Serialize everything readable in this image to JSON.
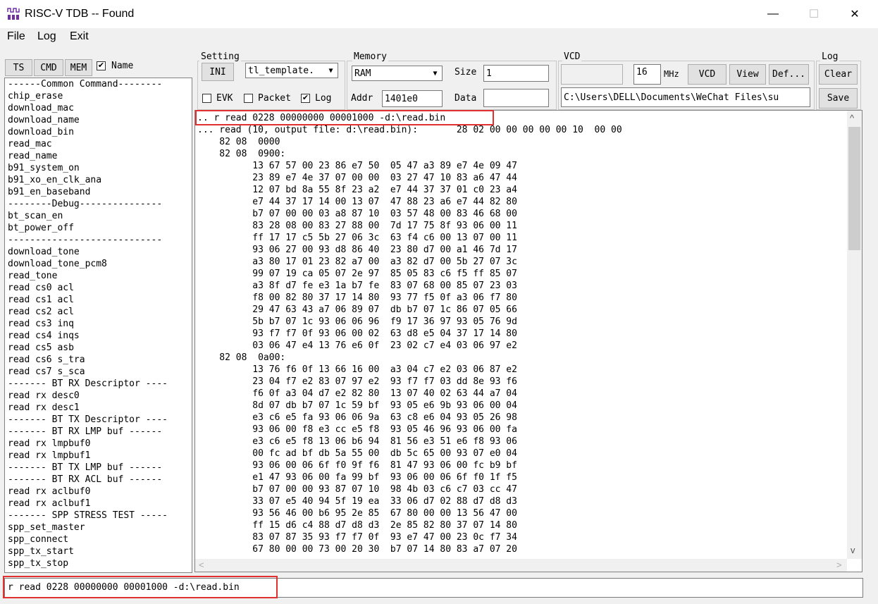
{
  "window": {
    "title": "RISC-V TDB -- Found",
    "min_glyph": "—",
    "max_glyph": "☐",
    "close_glyph": "✕"
  },
  "menu": [
    "File",
    "Log",
    "Exit"
  ],
  "left_tabs": {
    "ts": "TS",
    "cmd": "CMD",
    "mem": "MEM",
    "name_checked": true,
    "name_label": "Name"
  },
  "commands": [
    "------Common Command--------",
    "chip_erase",
    "download_mac",
    "download_name",
    "download_bin",
    "read_mac",
    "read_name",
    "b91_system_on",
    "b91_xo_en_clk_ana",
    "b91_en_baseband",
    "--------Debug---------------",
    "bt_scan_en",
    "bt_power_off",
    "----------------------------",
    "download_tone",
    "download_tone_pcm8",
    "read_tone",
    "read cs0 acl",
    "read cs1 acl",
    "read cs2 acl",
    "read cs3 inq",
    "read cs4 inqs",
    "read cs5 asb",
    "read cs6 s_tra",
    "read cs7 s_sca",
    "------- BT RX Descriptor ----",
    "read rx desc0",
    "read rx desc1",
    "------- BT TX Descriptor ----",
    "------- BT RX LMP buf ------",
    "read rx lmpbuf0",
    "read rx lmpbuf1",
    "------- BT TX LMP buf ------",
    "------- BT RX ACL buf ------",
    "read rx aclbuf0",
    "read rx aclbuf1",
    "------- SPP STRESS TEST -----",
    "spp_set_master",
    "spp_connect",
    "spp_tx_start",
    "spp_tx_stop"
  ],
  "setting": {
    "group_label": "Setting",
    "ini_button": "INI",
    "template_value": "tl_template.",
    "evk_label": "EVK",
    "evk_checked": false,
    "packet_label": "Packet",
    "packet_checked": false,
    "log_label": "Log",
    "log_checked": true
  },
  "memory": {
    "group_label": "Memory",
    "type_value": "RAM",
    "size_label": "Size",
    "size_value": "1",
    "addr_label": "Addr",
    "addr_value": "1401e0",
    "data_label": "Data",
    "data_value": ""
  },
  "vcd": {
    "group_label": "VCD",
    "mhz_value": "16",
    "mhz_label": "MHz",
    "vcd_button": "VCD",
    "view_button": "View",
    "def_button": "Def...",
    "path_value": "C:\\Users\\DELL\\Documents\\WeChat Files\\su"
  },
  "log": {
    "group_label": "Log",
    "clear_button": "Clear",
    "save_button": "Save"
  },
  "output_lines": [
    ".. r read 0228 00000000 00001000 -d:\\read.bin",
    "... read (10, output file: d:\\read.bin):       28 02 00 00 00 00 00 10  00 00",
    "    82 08  0000",
    "    82 08  0900:",
    "          13 67 57 00 23 86 e7 50  05 47 a3 89 e7 4e 09 47",
    "          23 89 e7 4e 37 07 00 00  03 27 47 10 83 a6 47 44",
    "          12 07 bd 8a 55 8f 23 a2  e7 44 37 37 01 c0 23 a4",
    "          e7 44 37 17 14 00 13 07  47 88 23 a6 e7 44 82 80",
    "          b7 07 00 00 03 a8 87 10  03 57 48 00 83 46 68 00",
    "          83 28 08 00 83 27 88 00  7d 17 75 8f 93 06 00 11",
    "          ff 17 17 c5 5b 27 06 3c  63 f4 c6 00 13 07 00 11",
    "          93 06 27 00 93 d8 86 40  23 80 d7 00 a1 46 7d 17",
    "          a3 80 17 01 23 82 a7 00  a3 82 d7 00 5b 27 07 3c",
    "          99 07 19 ca 05 07 2e 97  85 05 83 c6 f5 ff 85 07",
    "          a3 8f d7 fe e3 1a b7 fe  83 07 68 00 85 07 23 03",
    "          f8 00 82 80 37 17 14 80  93 77 f5 0f a3 06 f7 80",
    "          29 47 63 43 a7 06 89 07  db b7 07 1c 86 07 05 66",
    "          5b b7 07 1c 93 06 06 96  f9 17 36 97 93 05 76 9d",
    "          93 f7 f7 0f 93 06 00 02  63 d8 e5 04 37 17 14 80",
    "          03 06 47 e4 13 76 e6 0f  23 02 c7 e4 03 06 97 e2",
    "    82 08  0a00:",
    "          13 76 f6 0f 13 66 16 00  a3 04 c7 e2 03 06 87 e2",
    "          23 04 f7 e2 83 07 97 e2  93 f7 f7 03 dd 8e 93 f6",
    "          f6 0f a3 04 d7 e2 82 80  13 07 40 02 63 44 a7 04",
    "          8d 07 db b7 07 1c 59 bf  93 05 e6 9b 93 06 00 04",
    "          e3 c6 e5 fa 93 06 06 9a  63 c8 e6 04 93 05 26 98",
    "          93 06 00 f8 e3 cc e5 f8  93 05 46 96 93 06 00 fa",
    "          e3 c6 e5 f8 13 06 b6 94  81 56 e3 51 e6 f8 93 06",
    "          00 fc ad bf db 5a 55 00  db 5c 65 00 93 07 e0 04",
    "          93 06 00 06 6f f0 9f f6  81 47 93 06 00 fc b9 bf",
    "          e1 47 93 06 00 fa 99 bf  93 06 00 06 6f f0 1f f5",
    "          b7 07 00 00 93 87 07 10  98 4b 03 c6 c7 03 cc 47",
    "          33 07 e5 40 94 5f 19 ea  33 06 d7 02 88 d7 d8 d3",
    "          93 56 46 00 b6 95 2e 85  67 80 00 00 13 56 47 00",
    "          ff 15 d6 c4 88 d7 d8 d3  2e 85 82 80 37 07 14 80",
    "          83 07 87 35 93 f7 f7 0f  93 e7 47 00 23 0c f7 34",
    "          67 80 00 00 73 00 20 30  b7 07 14 80 83 a7 07 20"
  ],
  "scroll_glyphs": {
    "up": "^",
    "down": "v",
    "left": "<",
    "right": ">"
  },
  "command_input": "r read 0228 00000000 00001000 -d:\\read.bin"
}
